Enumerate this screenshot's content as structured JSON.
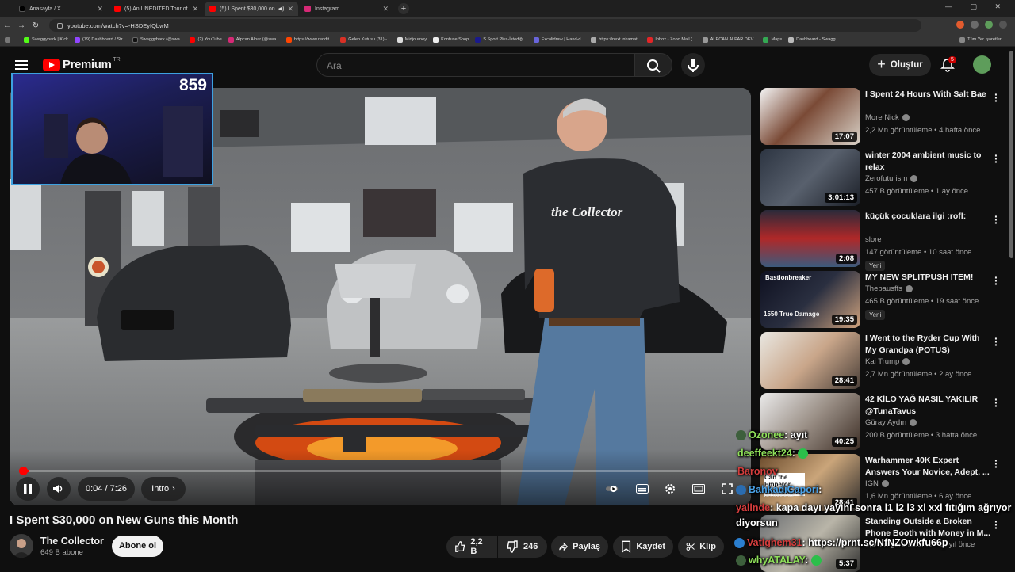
{
  "browser": {
    "tabs": [
      {
        "label": "Anasayfa / X",
        "color": "#000000"
      },
      {
        "label": "(5) An UNEDITED Tour of My $",
        "color": "#ff0000"
      },
      {
        "label": "(5) I Spent $30,000 on New",
        "color": "#ff0000"
      },
      {
        "label": "Instagram",
        "color": "#d62976"
      }
    ],
    "url": "youtube.com/watch?v=-HSDEyfQbwM",
    "bookmarks": [
      "Swaggybark | Kick",
      "(79) Dashboard / Str...",
      "Swaggybark (@swa...",
      "(2) YouTube",
      "Alpcan Alpar (@swa...",
      "https://www.reddit....",
      "Gelen Kutusu (31) -...",
      "Midjourney",
      "Konfuse Shop",
      "S Sport Plus-İstediği...",
      "Excalidraw | Hand-d...",
      "https://next.inkamat...",
      "Inbox - Zoho Mail (...",
      "ALPCAN ALPAR DEV...",
      "Maps",
      "Dashboard - Swagg..."
    ],
    "bookmarks_right": "Tüm Yer İşaretleri"
  },
  "header": {
    "logo_text": "Premium",
    "logo_region": "TR",
    "search_placeholder": "Ara",
    "create_label": "Oluştur",
    "notifications": "5"
  },
  "overlay": {
    "viewer_count": "859"
  },
  "player": {
    "time": "0:04 / 7:26",
    "chapter": "Intro",
    "progress": 0.009
  },
  "video": {
    "title": "I Spent $30,000 on New Guns this Month",
    "channel": "The Collector",
    "subscribers": "649 B abone",
    "subscribe_label": "Abone ol",
    "likes": "2,2 B",
    "dislikes": "246",
    "share_label": "Paylaş",
    "save_label": "Kaydet",
    "clip_label": "Klip",
    "shirt_text": "the Collector"
  },
  "recommendations": [
    {
      "title": "I Spent 24 Hours With Salt Bae",
      "channel": "More Nick",
      "verified": true,
      "meta": "2,2 Mn görüntüleme • 4 hafta önce",
      "duration": "17:07",
      "badge": ""
    },
    {
      "title": "winter 2004 ambient music to relax",
      "channel": "Zerofuturism",
      "verified": true,
      "meta": "457 B görüntüleme • 1 ay önce",
      "duration": "3:01:13",
      "badge": ""
    },
    {
      "title": "küçük çocuklara ilgi :rofl:",
      "channel": "slore",
      "verified": false,
      "meta": "147 görüntüleme • 10 saat önce",
      "duration": "2:08",
      "badge": "Yeni"
    },
    {
      "title": "MY NEW SPLITPUSH ITEM!",
      "channel": "Thebausffs",
      "verified": true,
      "meta": "465 B görüntüleme • 19 saat önce",
      "duration": "19:35",
      "badge": "Yeni"
    },
    {
      "title": "I Went to the Ryder Cup With My Grandpa (POTUS)",
      "channel": "Kai Trump",
      "verified": true,
      "meta": "2,7 Mn görüntüleme • 2 ay önce",
      "duration": "28:41",
      "badge": ""
    },
    {
      "title": "42 KİLO YAĞ NASIL YAKILIR @TunaTavus",
      "channel": "Güray Aydın",
      "verified": true,
      "meta": "200 B görüntüleme • 3 hafta önce",
      "duration": "40:25",
      "badge": ""
    },
    {
      "title": "Warhammer 40K Expert Answers Your Novice, Adept, ...",
      "channel": "IGN",
      "verified": true,
      "meta": "1,6 Mn görüntüleme • 6 ay önce",
      "duration": "28:41",
      "badge": ""
    },
    {
      "title": "Standing Outside a Broken Phone Booth with Money in M...",
      "channel": "",
      "verified": false,
      "meta": "5,3 Mn görüntüleme • 11 yıl önce",
      "duration": "5:37",
      "badge": ""
    }
  ],
  "thumb_texts": {
    "splitpush_1": "Bastionbreaker",
    "splitpush_2": "1550 True Damage",
    "warhammer": "Can the Emperor ever return?",
    "warhammer_2": "WARHAMMER"
  },
  "chat": [
    {
      "name": "Ozonee",
      "msg": ": ayıt",
      "color": "green"
    },
    {
      "name": "deeffeekt24",
      "msg": ":",
      "color": "green"
    },
    {
      "name": "Baronov",
      "msg": "",
      "color": "red"
    },
    {
      "name": "BahkadiCapori",
      "msg": ":",
      "color": "blue"
    },
    {
      "name": "yallnde",
      "msg": ": kapa dayı yayını sonra l1 l2 l3 xl xxl fıtığım ağrıyor",
      "color": "red"
    },
    {
      "name": "",
      "msg": "diyorsun",
      "color": "white"
    },
    {
      "name": "Vatighem31",
      "msg": ": https://prnt.sc/NfNZOwkfu66p",
      "color": "red"
    },
    {
      "name": "whyATALAY",
      "msg": ":",
      "color": "green"
    }
  ]
}
